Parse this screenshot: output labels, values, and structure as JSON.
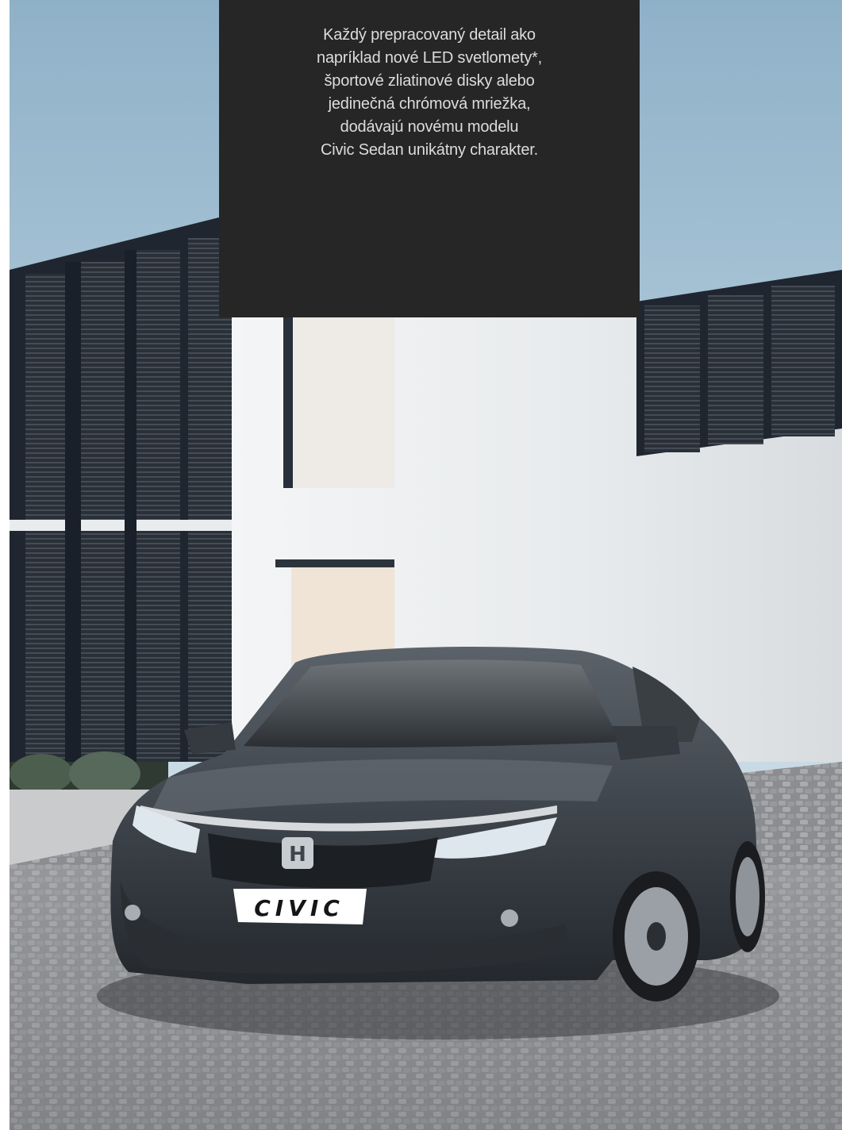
{
  "brochure": {
    "intro_lines": [
      "Každý prepracovaný detail ako",
      "napríklad nové LED svetlomety*,",
      "športové zliatinové disky alebo",
      "jedinečná chrómová mriežka,",
      "dodávajú novému modelu",
      "Civic Sedan unikátny charakter."
    ]
  },
  "photo": {
    "badge_text": "CIVIC",
    "colors": {
      "text_panel": "#262626",
      "text": "#dcdcdc",
      "car_body": "#3e444b",
      "pavement": "#8d8e90"
    }
  }
}
